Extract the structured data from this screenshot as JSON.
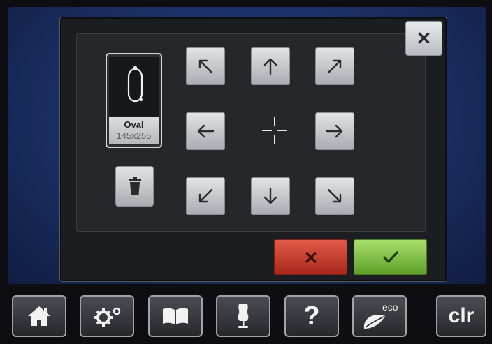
{
  "dialog": {
    "close_symbol": "✕",
    "hoop": {
      "name": "Oval",
      "size": "145x255",
      "icon": "oval-hoop-icon"
    },
    "move_buttons": [
      {
        "dir": "up-left",
        "icon": "arrow-up-left-icon"
      },
      {
        "dir": "up",
        "icon": "arrow-up-icon"
      },
      {
        "dir": "up-right",
        "icon": "arrow-up-right-icon"
      },
      {
        "dir": "left",
        "icon": "arrow-left-icon"
      },
      {
        "dir": "right",
        "icon": "arrow-right-icon"
      },
      {
        "dir": "down-left",
        "icon": "arrow-down-left-icon"
      },
      {
        "dir": "down",
        "icon": "arrow-down-icon"
      },
      {
        "dir": "down-right",
        "icon": "arrow-down-right-icon"
      }
    ],
    "center_icon": "crosshair-icon",
    "delete_icon": "trash-icon",
    "cancel_icon": "x-icon",
    "confirm_icon": "check-icon",
    "colors": {
      "cancel": "#c0392b",
      "confirm": "#7cc242"
    }
  },
  "bottom_bar": {
    "items": [
      {
        "id": "home",
        "icon": "home-icon"
      },
      {
        "id": "settings",
        "icon": "gear-icon"
      },
      {
        "id": "tutorial",
        "icon": "book-icon"
      },
      {
        "id": "consultant",
        "icon": "dress-form-icon"
      },
      {
        "id": "help",
        "icon": "help-icon",
        "label": "?"
      },
      {
        "id": "eco",
        "icon": "eco-leaf-icon",
        "label": "eco"
      },
      {
        "id": "clear",
        "icon": "clr-icon",
        "label": "clr"
      }
    ]
  }
}
